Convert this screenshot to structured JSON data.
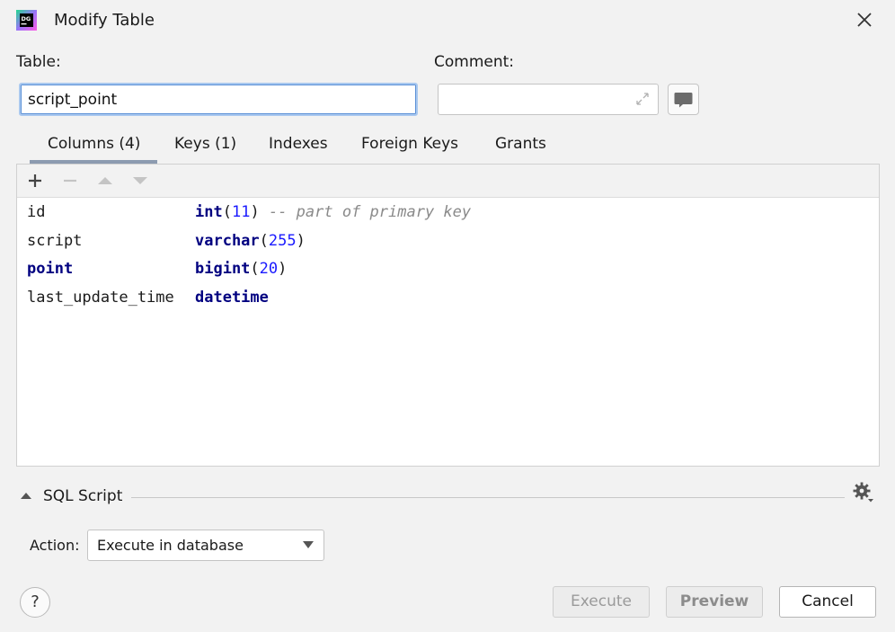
{
  "window": {
    "title": "Modify Table",
    "app_icon_text": "DG"
  },
  "form": {
    "table_label": "Table:",
    "table_value": "script_point",
    "comment_label": "Comment:",
    "comment_value": ""
  },
  "tabs": [
    {
      "label": "Columns (4)",
      "active": true
    },
    {
      "label": "Keys (1)",
      "active": false
    },
    {
      "label": "Indexes",
      "active": false
    },
    {
      "label": "Foreign Keys",
      "active": false
    },
    {
      "label": "Grants",
      "active": false
    }
  ],
  "toolbar": {
    "icons": [
      "add-icon",
      "remove-icon",
      "move-up-icon",
      "move-down-icon"
    ]
  },
  "columns": [
    {
      "name": "id",
      "type_kw": "int",
      "paren_open": "(",
      "type_arg": "11",
      "paren_close": ")",
      "comment": "-- part of primary key"
    },
    {
      "name": "script",
      "type_kw": "varchar",
      "paren_open": "(",
      "type_arg": "255",
      "paren_close": ")",
      "comment": ""
    },
    {
      "name": "point",
      "type_kw": "bigint",
      "paren_open": "(",
      "type_arg": "20",
      "paren_close": ")",
      "comment": ""
    },
    {
      "name": "last_update_time",
      "type_kw": "datetime",
      "paren_open": "",
      "type_arg": "",
      "paren_close": "",
      "comment": ""
    }
  ],
  "sql_script": {
    "label": "SQL Script",
    "action_label": "Action:",
    "action_value": "Execute in database"
  },
  "buttons": {
    "help": "?",
    "execute": "Execute",
    "preview": "Preview",
    "cancel": "Cancel"
  },
  "colors": {
    "keyword": "#000080",
    "number": "#1a1aff",
    "comment": "#8a8a8a",
    "focus_border": "#5a8fd6"
  }
}
